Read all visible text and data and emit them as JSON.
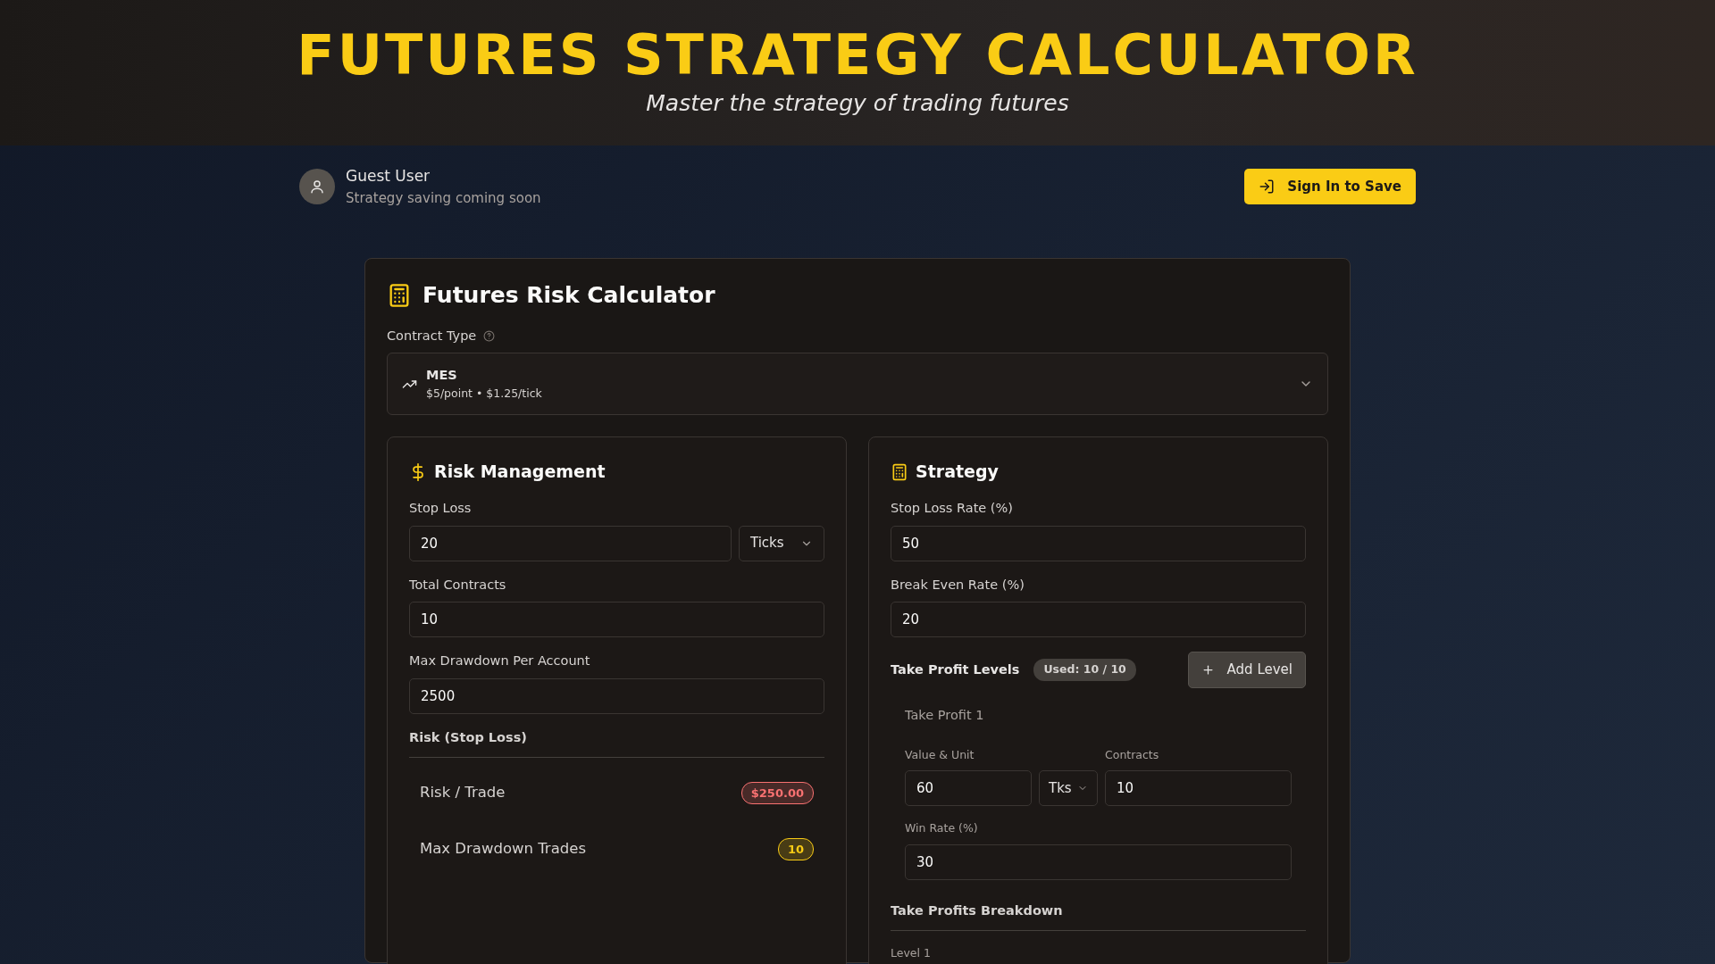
{
  "header": {
    "title": "FUTURES STRATEGY CALCULATOR",
    "subtitle": "Master the strategy of trading futures"
  },
  "user": {
    "name": "Guest User",
    "note": "Strategy saving coming soon",
    "button": "Sign In to Save"
  },
  "calculator": {
    "title": "Futures Risk Calculator",
    "contract_label": "Contract Type",
    "contract": {
      "symbol": "MES",
      "detail": "$5/point • $1.25/tick"
    }
  },
  "risk": {
    "title": "Risk Management",
    "fields": [
      {
        "label": "Stop Loss",
        "value": "20",
        "unit": "Ticks"
      },
      {
        "label": "Total Contracts",
        "value": "10"
      },
      {
        "label": "Max Drawdown Per Account",
        "value": "2500"
      }
    ],
    "section": "Risk (Stop Loss)",
    "results": [
      {
        "label": "Risk / Trade",
        "value": "$250.00",
        "color": "#f87171"
      },
      {
        "label": "Max Drawdown Trades",
        "value": "10",
        "color": "#facc15"
      }
    ]
  },
  "strategy": {
    "title": "Strategy",
    "fields": [
      {
        "label": "Stop Loss Rate (%)",
        "value": "50"
      },
      {
        "label": "Break Even Rate (%)",
        "value": "20"
      }
    ],
    "levels_label": "Take Profit Levels",
    "used": "Used: 10 / 10",
    "add_button": "Add Level",
    "levels": [
      {
        "title": "Take Profit 1",
        "value_label": "Value & Unit",
        "value": "60",
        "unit": "Tks",
        "contracts_label": "Contracts",
        "contracts": "10",
        "win_label": "Win Rate (%)",
        "win": "30"
      }
    ],
    "breakdown_title": "Take Profits Breakdown",
    "breakdown": [
      "Level 1"
    ]
  }
}
